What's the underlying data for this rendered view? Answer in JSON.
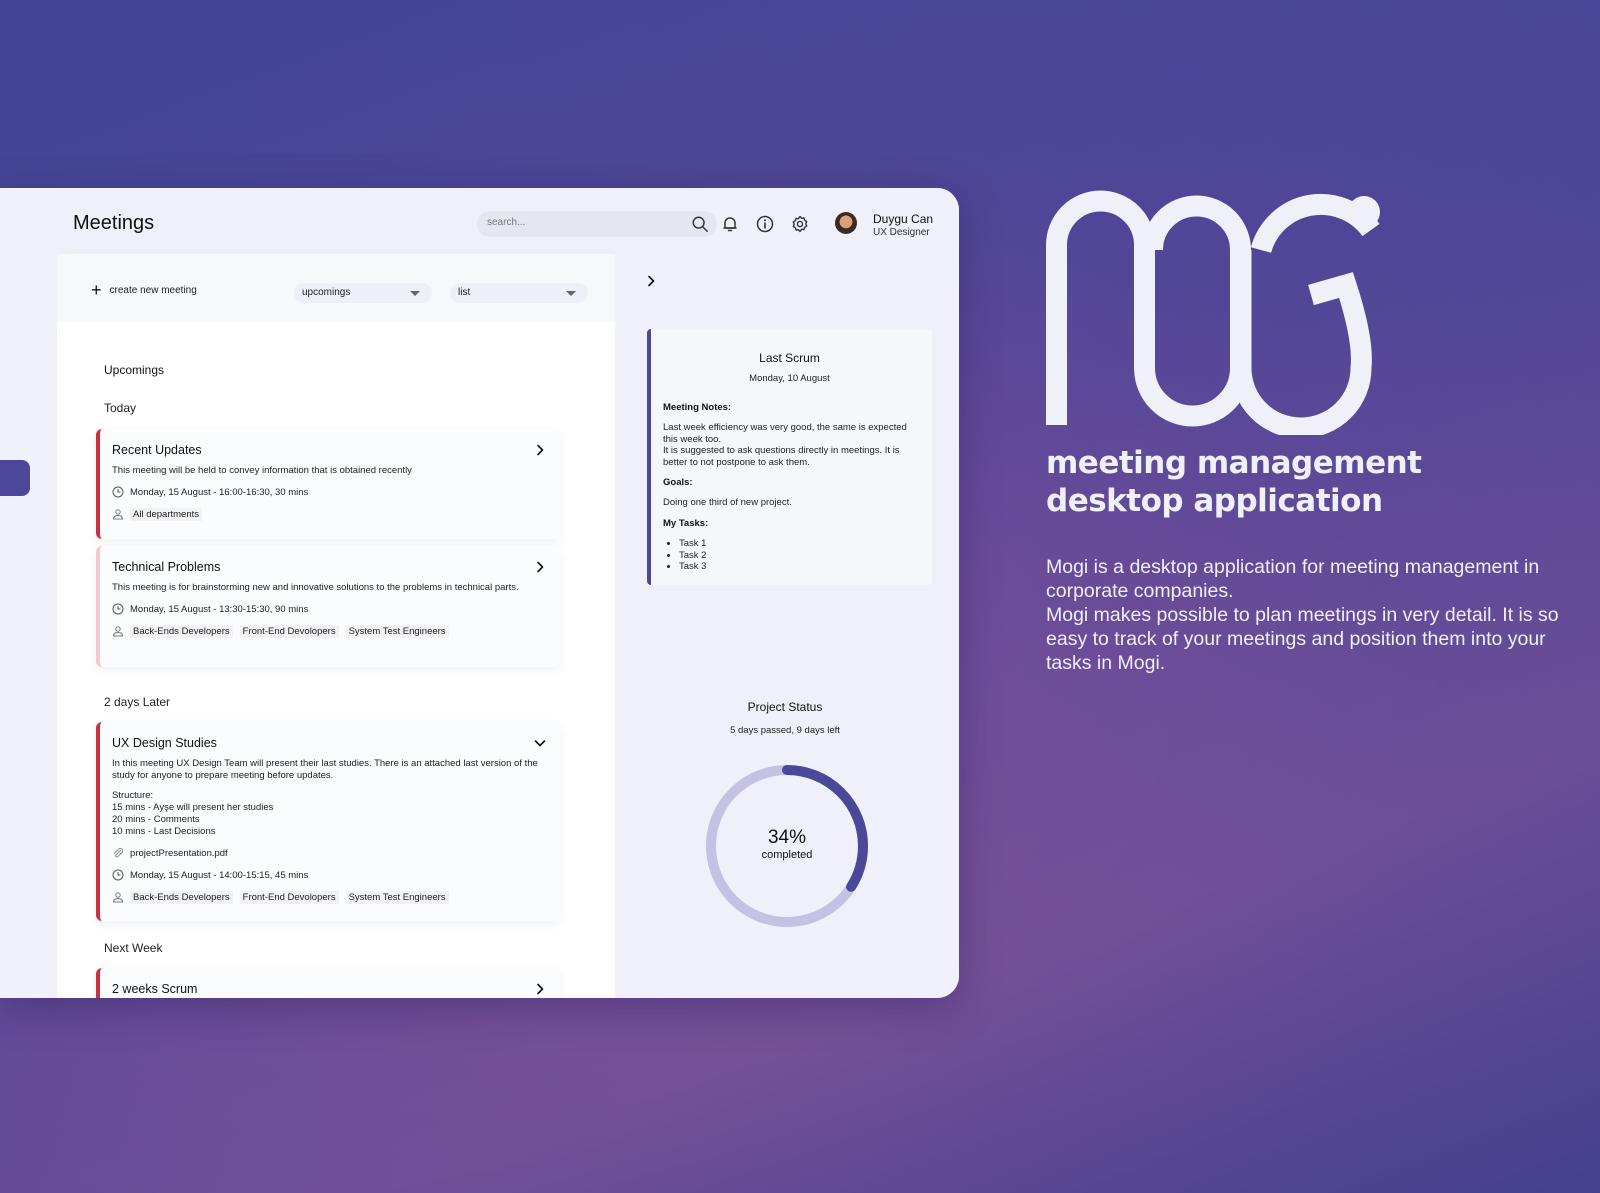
{
  "app": {
    "page_title": "Meetings",
    "search": {
      "placeholder": "search...",
      "value": ""
    },
    "header_icons": [
      "bell-icon",
      "info-icon",
      "gear-icon"
    ],
    "user": {
      "name": "Duygu Can",
      "role": "UX Designer"
    }
  },
  "toolbar": {
    "create_label": "create new meeting",
    "filter_selected": "upcomings",
    "view_selected": "list"
  },
  "list": {
    "section_title": "Upcomings",
    "groups": [
      {
        "label": "Today",
        "meetings": [
          {
            "title": "Recent Updates",
            "description": "This meeting will be held to convey information that is obtained recently",
            "time": "Monday, 15 August - 16:00-16:30, 30 mins",
            "participants": [
              "All departments"
            ]
          },
          {
            "title": "Technical Problems",
            "description": "This meeting is for brainstorming new and innovative solutions to the problems in technical parts.",
            "time": "Monday, 15 August - 13:30-15:30, 90 mins",
            "participants": [
              "Back-Ends Developers",
              "Front-End Devolopers",
              "System Test Engineers"
            ]
          }
        ]
      },
      {
        "label": "2 days Later",
        "meetings": [
          {
            "title": "UX Design Studies",
            "description": "In this meeting UX Design Team will present their last studies. There is an attached last version of the study for anyone to prepare meeting before updates.",
            "structure": [
              "Structure:",
              "15 mins - Ayşe will present her studies",
              "20 mins - Comments",
              "10 mins - Last Decisions"
            ],
            "attachment": "projectPresentation.pdf",
            "time": "Monday, 15 August - 14:00-15:15, 45 mins",
            "participants": [
              "Back-Ends Developers",
              "Front-End Devolopers",
              "System Test Engineers"
            ],
            "expanded": true
          }
        ]
      },
      {
        "label": "Next Week",
        "meetings": [
          {
            "title": "2 weeks Scrum"
          }
        ]
      }
    ]
  },
  "detail": {
    "last_scrum": {
      "title": "Last Scrum",
      "date": "Monday, 10 August",
      "notes_heading": "Meeting Notes:",
      "notes": "Last week efficiency was very good, the same is expected this week too.",
      "notes_2": "It is suggested to ask questions directly in meetings. It is better to not postpone to ask them.",
      "goals_heading": "Goals:",
      "goals": "Doing one third of new project.",
      "tasks_heading": "My Tasks:",
      "tasks": [
        "Task 1",
        "Task 2",
        "Task 3"
      ]
    },
    "project_status": {
      "title": "Project Status",
      "subtitle": "5 days passed, 9 days left",
      "percent_label": "34%",
      "completed_label": "completed",
      "progress": 0.34
    }
  },
  "colors": {
    "accent": "#4b4899",
    "accent_light": "#c4c1e2",
    "urgent": "#cc2e42",
    "urgent_light": "#f5c8cf"
  },
  "promo": {
    "brand": "mogi",
    "tagline_1": "meeting management",
    "tagline_2": "desktop application",
    "description_1": "Mogi is a desktop application for meeting management in corporate companies.",
    "description_2": "Mogi makes possible to plan meetings in very detail.  It is so easy to track of your meetings and position them into your tasks in Mogi."
  }
}
